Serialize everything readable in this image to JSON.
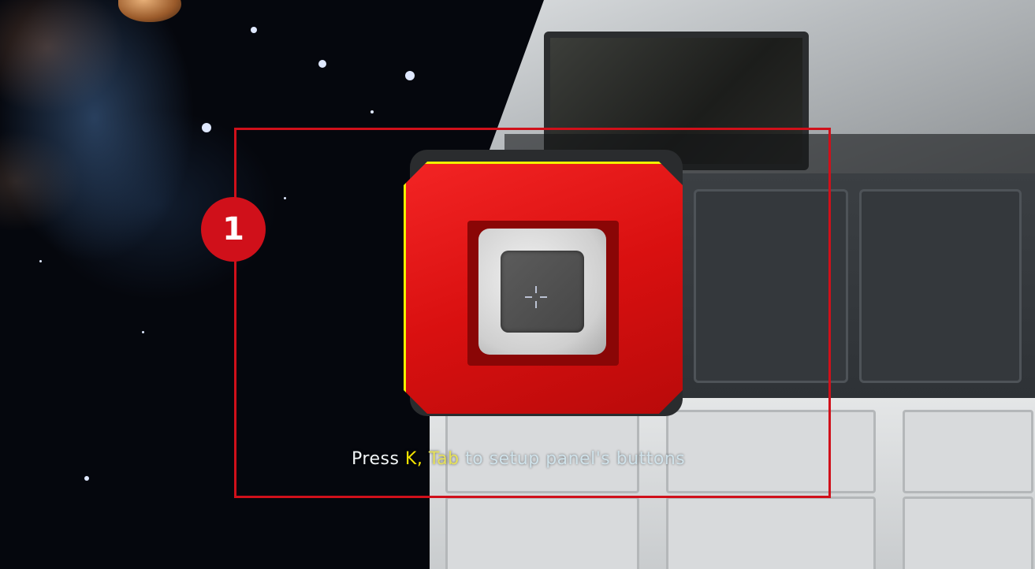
{
  "hud": {
    "hint_press": "Press ",
    "hint_key1": "K",
    "hint_sep": ", ",
    "hint_key2": "Tab",
    "hint_rest": " to setup panel's buttons"
  },
  "annotation": {
    "step_number": "1"
  },
  "colors": {
    "annotation_red": "#d0101a",
    "button_red": "#e01414",
    "highlight_yellow": "#f1f000",
    "key_yellow": "#f4e400"
  },
  "icons": {
    "crosshair": "crosshair-icon"
  }
}
